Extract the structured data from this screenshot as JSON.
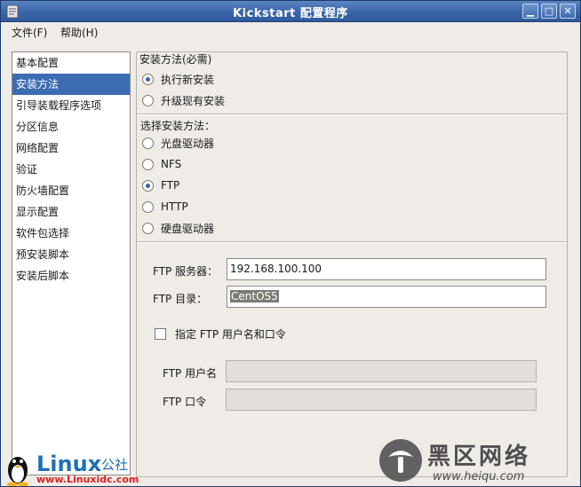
{
  "window": {
    "title": "Kickstart 配置程序",
    "minimize_glyph": "▁",
    "maximize_glyph": "□",
    "close_glyph": "✕"
  },
  "menu": {
    "file": "文件(F)",
    "help": "帮助(H)"
  },
  "sidebar": {
    "items": [
      {
        "label": "基本配置"
      },
      {
        "label": "安装方法"
      },
      {
        "label": "引导装载程序选项"
      },
      {
        "label": "分区信息"
      },
      {
        "label": "网络配置"
      },
      {
        "label": "验证"
      },
      {
        "label": "防火墙配置"
      },
      {
        "label": "显示配置"
      },
      {
        "label": "软件包选择"
      },
      {
        "label": "预安装脚本"
      },
      {
        "label": "安装后脚本"
      }
    ],
    "selected_index": 1
  },
  "install": {
    "group_title": "安装方法(必需)",
    "options": [
      {
        "label": "执行新安装",
        "checked": true
      },
      {
        "label": "升级现有安装",
        "checked": false
      }
    ]
  },
  "method": {
    "label": "选择安装方法：",
    "options": [
      {
        "label": "光盘驱动器",
        "checked": false
      },
      {
        "label": "NFS",
        "checked": false
      },
      {
        "label": "FTP",
        "checked": true
      },
      {
        "label": "HTTP",
        "checked": false
      },
      {
        "label": "硬盘驱动器",
        "checked": false
      }
    ]
  },
  "ftp": {
    "server_label": "FTP 服务器：",
    "server_value": "192.168.100.100",
    "dir_label": "FTP 目录：",
    "dir_value": "CentOS5",
    "auth_checkbox_label": "指定 FTP 用户名和口令",
    "auth_checked": false,
    "username_label": "FTP 用户名",
    "username_value": "",
    "password_label": "FTP 口令",
    "password_value": ""
  },
  "watermarks": {
    "left_brand": "Linux",
    "left_suffix": "公社",
    "left_url": "www.Linuxidc.com",
    "right_brand": "黑区网络",
    "right_url": "www.heiqu.com"
  },
  "colors": {
    "titlebar": "#3b68aa",
    "selection": "#3d6cb3",
    "window_bg": "#efebe7"
  }
}
